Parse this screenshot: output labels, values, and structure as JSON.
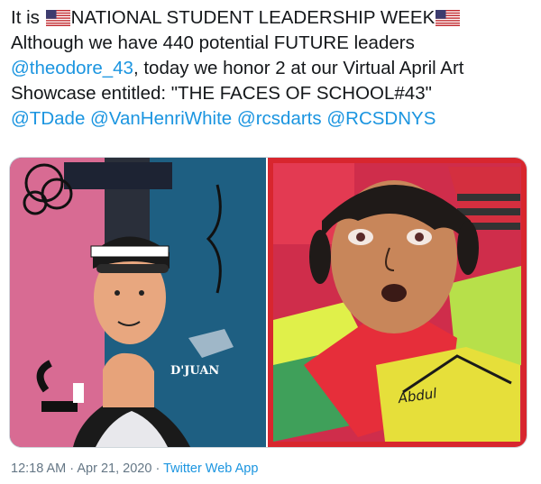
{
  "tweet": {
    "line1_pre": "It is",
    "line1_post": "NATIONAL STUDENT LEADERSHIP WEEK",
    "line2": "Although we have 440 potential FUTURE leaders",
    "line3_mention": "@theodore_43",
    "line3_rest": ", today we honor 2 at our Virtual April Art",
    "line4": "Showcase entitled: \"THE FACES OF SCHOOL#43\"",
    "mentions": [
      "@TDade",
      "@VanHenriWhite",
      "@rcsdarts",
      "@RCSDNYS"
    ],
    "flag_icon": "us-flag-icon"
  },
  "media": {
    "left_caption": "D'JUAN",
    "right_caption": "Abdul"
  },
  "meta": {
    "time": "12:18 AM",
    "date": "Apr 21, 2020",
    "separator": "·",
    "source": "Twitter Web App"
  },
  "colors": {
    "link": "#1b95e0",
    "meta": "#657786",
    "text": "#14171a"
  }
}
